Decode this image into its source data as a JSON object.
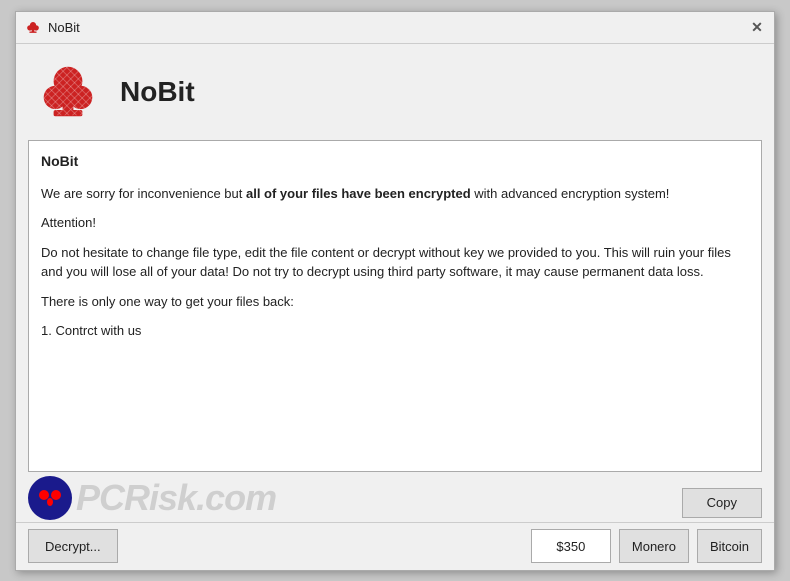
{
  "window": {
    "title": "NoBit",
    "close_label": "✕"
  },
  "header": {
    "app_name": "NoBit"
  },
  "content": {
    "title": "NoBit",
    "paragraph1_prefix": "We are sorry for inconvenience but ",
    "paragraph1_bold": "all of your files have been encrypted",
    "paragraph1_suffix": " with advanced encryption system!",
    "paragraph2": "Attention!",
    "paragraph3": "Do not hesitate to change file type, edit the file content or decrypt without key we provided to you. This will ruin your files and you will lose all of your data! Do not try to decrypt using third party software, it may cause permanent data loss.",
    "paragraph4": "There is only one way to get your files back:",
    "paragraph5": "1. Contrct with us"
  },
  "bottom_bar": {
    "decrypt_label": "Decrypt...",
    "price_value": "$350",
    "monero_label": "Monero",
    "bitcoin_label": "Bitcoin"
  },
  "copy_bar": {
    "copy_label": "Copy"
  },
  "watermark": {
    "site": "PCRisk.com"
  }
}
